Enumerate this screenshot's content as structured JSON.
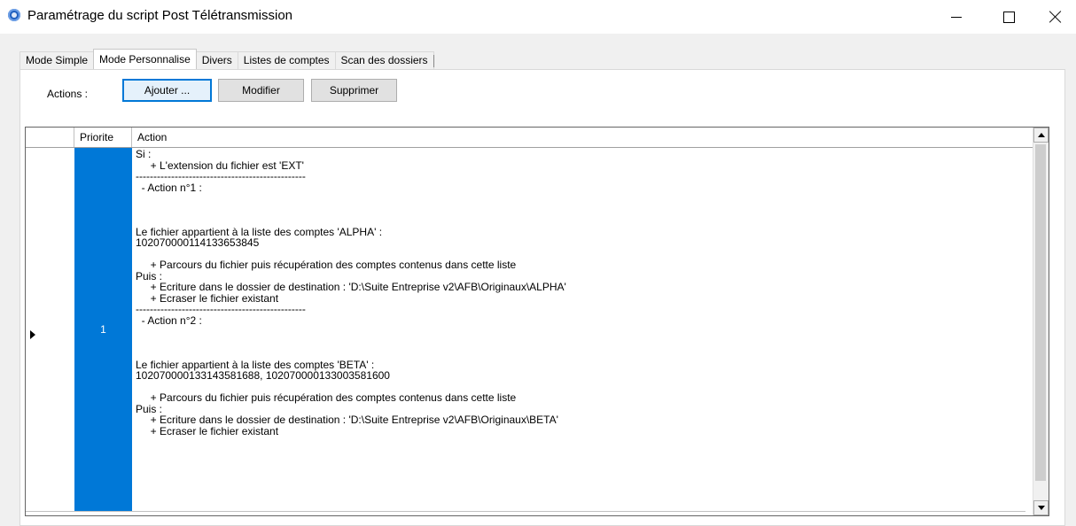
{
  "window": {
    "title": "Paramétrage du script Post Télétransmission",
    "icon": "app-gear-icon",
    "controls": [
      "minimize-icon",
      "maximize-icon",
      "close-icon"
    ]
  },
  "tabs": [
    {
      "label": "Mode Simple",
      "active": false
    },
    {
      "label": "Mode Personnalise",
      "active": true
    },
    {
      "label": "Divers",
      "active": false
    },
    {
      "label": "Listes de comptes",
      "active": false
    },
    {
      "label": "Scan des dossiers",
      "active": false
    }
  ],
  "actions": {
    "label": "Actions :",
    "add": "Ajouter ...",
    "edit": "Modifier",
    "delete": "Supprimer"
  },
  "grid": {
    "headers": {
      "priority": "Priorite",
      "action": "Action"
    },
    "rows": [
      {
        "priority": "1",
        "selected": true,
        "action": "Si :\n     + L'extension du fichier est 'EXT'\n------------------------------------------------\n  - Action n°1 :\n\n\n\nLe fichier appartient à la liste des comptes 'ALPHA' :\n10207000011413365 3845\n\n     + Parcours du fichier puis récupération des comptes contenus dans cette liste\nPuis :\n     + Ecriture dans le dossier de destination : 'D:\\Suite Entreprise v2\\AFB\\Originaux\\ALPHA'\n     + Ecraser le fichier existant\n------------------------------------------------\n  - Action n°2 :\n\n\n\nLe fichier appartient à la liste des comptes 'BETA' :\n10207000013314358 1688, 10207000013300358 1600\n\n     + Parcours du fichier puis récupération des comptes contenus dans cette liste\nPuis :\n     + Ecriture dans le dossier de destination : 'D:\\Suite Entreprise v2\\AFB\\Originaux\\BETA'\n     + Ecraser le fichier existant"
      }
    ]
  },
  "colors": {
    "selection": "#0078d7",
    "accent_border": "#0078d7"
  }
}
